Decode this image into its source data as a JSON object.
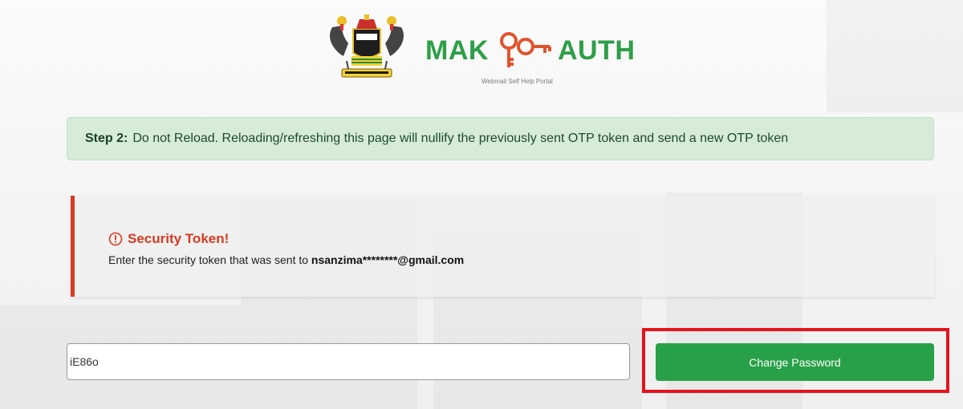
{
  "header": {
    "brand_left": "MAK",
    "brand_right": "AUTH",
    "tagline": "Webmail Self Help Portal",
    "brand_color": "#2e9e49",
    "key_color": "#e0542e"
  },
  "step_alert": {
    "step_label": "Step 2:",
    "message": "Do not Reload. Reloading/refreshing this page will nullify the previously sent OTP token and send a new OTP token"
  },
  "token_card": {
    "title": "Security Token!",
    "text_prefix": "Enter the security token that was sent to",
    "email": "nsanzima********@gmail.com",
    "accent": "#d63b22"
  },
  "form": {
    "token_value": "iE86o",
    "submit_label": "Change Password",
    "button_color": "#28a048"
  }
}
